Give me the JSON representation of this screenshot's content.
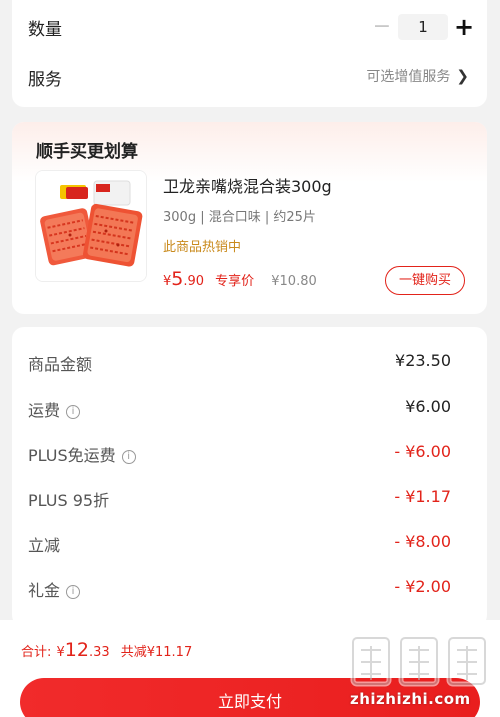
{
  "top": {
    "quantity_label": "数量",
    "quantity_value": "1",
    "minus_symbol": "−",
    "plus_symbol": "+",
    "service_label": "服务",
    "service_value": "可选增值服务",
    "service_chevron": "❯"
  },
  "bundle": {
    "title": "顺手买更划算",
    "product_name": "卫龙亲嘴烧混合装300g",
    "product_spec": "300g | 混合口味 | 约25片",
    "hot_label": "此商品热销中",
    "price_currency": "¥",
    "price_int": "5",
    "price_dec": ".90",
    "price_tag": "专享价",
    "original_price": "¥10.80",
    "buy_button": "一键购买"
  },
  "fees": [
    {
      "label": "商品金额",
      "value": "¥23.50",
      "info": false,
      "negative": false
    },
    {
      "label": "运费",
      "value": "¥6.00",
      "info": true,
      "negative": false
    },
    {
      "label": "PLUS免运费",
      "value": "- ¥6.00",
      "info": true,
      "negative": true
    },
    {
      "label": "PLUS 95折",
      "value": "- ¥1.17",
      "info": false,
      "negative": true
    },
    {
      "label": "立减",
      "value": "- ¥8.00",
      "info": false,
      "negative": true
    },
    {
      "label": "礼金",
      "value": "- ¥2.00",
      "info": true,
      "negative": true
    }
  ],
  "footer": {
    "total_label": "合计:",
    "total_currency": "¥",
    "total_int": "12",
    "total_dec": ".33",
    "saved": "共减¥11.17",
    "pay_button": "立即支付",
    "watermark_text": "zhizhizhi.com"
  },
  "colors": {
    "accent": "#e2231a",
    "hot": "#c98a1c"
  }
}
